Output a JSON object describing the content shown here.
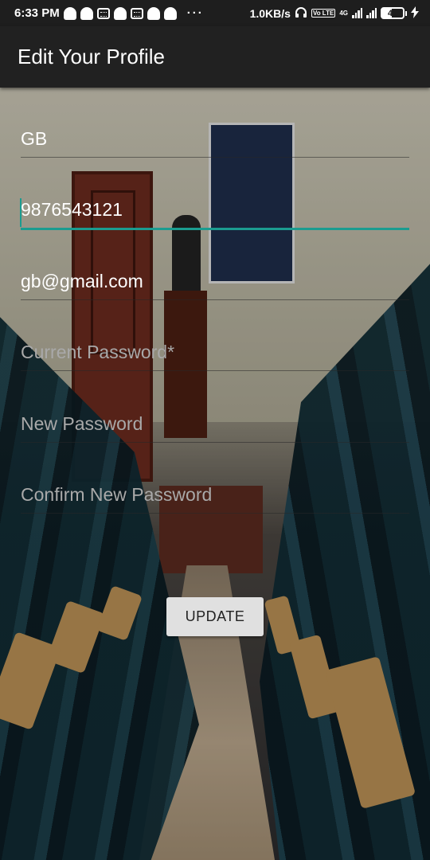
{
  "status_bar": {
    "time": "6:33 PM",
    "dots": "···",
    "net_speed": "1.0KB/s",
    "volte": "Vo LTE",
    "network": "4G",
    "battery": "46"
  },
  "app_bar": {
    "title": "Edit Your Profile"
  },
  "form": {
    "name_value": "GB",
    "phone_value": "9876543121",
    "email_value": "gb@gmail.com",
    "current_password_placeholder": "Current Password*",
    "new_password_placeholder": "New Password",
    "confirm_password_placeholder": "Confirm New Password",
    "update_label": "UPDATE"
  },
  "colors": {
    "accent": "#1b9c90",
    "app_bar_bg": "#212121",
    "status_bar_bg": "#1e1e1e",
    "button_bg": "#e0e0e0"
  }
}
